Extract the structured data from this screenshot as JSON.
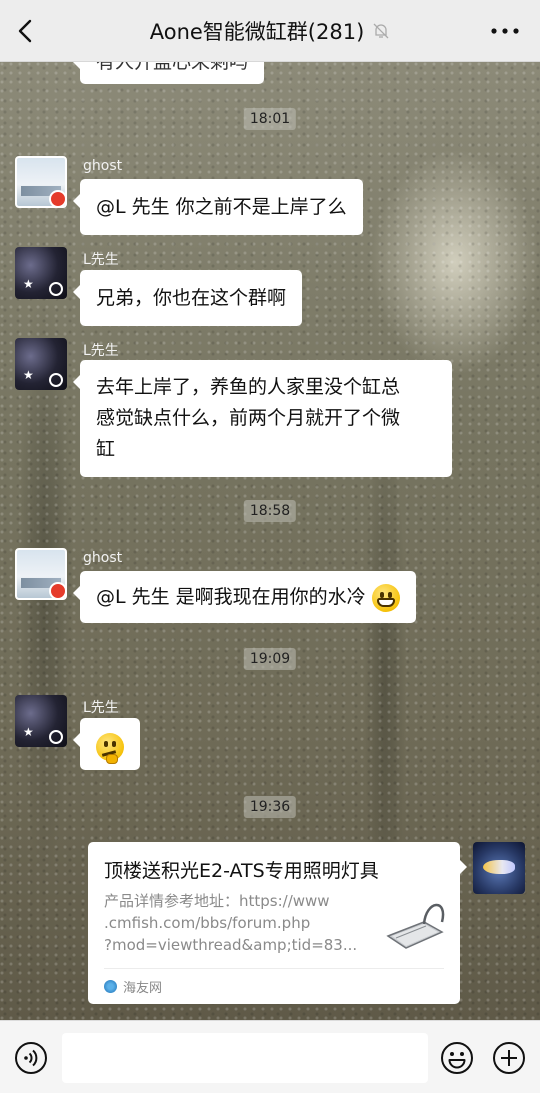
{
  "header": {
    "title": "Aone智能微缸群(281)",
    "back_icon": "chevron-left-icon",
    "mute_icon": "bell-mute-icon",
    "more_icon": "more-dots-icon"
  },
  "chat": {
    "partial_message": "有人开盖心来剩吗",
    "timestamps": [
      "18:01",
      "18:58",
      "19:09",
      "19:36"
    ],
    "messages": [
      {
        "sender": "ghost",
        "text": "@L 先生  你之前不是上岸了么"
      },
      {
        "sender": "L先生",
        "text": "兄弟，你也在这个群啊"
      },
      {
        "sender": "L先生",
        "lines": [
          "去年上岸了，养鱼的人家里没个缸总",
          "感觉缺点什么，前两个月就开了个微",
          "缸"
        ]
      },
      {
        "sender": "ghost",
        "text": "@L 先生  是啊我现在用你的水冷"
      },
      {
        "sender": "L先生",
        "emoji": "thinking-emoji"
      }
    ],
    "link_card": {
      "title": "顶楼送积光E2-ATS专用照明灯具",
      "desc_lines": [
        "产品详情参考地址：https://www",
        ".cmfish.com/bbs/forum.php",
        "?mod=viewthread&amp;tid=83..."
      ],
      "source": "海友网"
    }
  },
  "input_bar": {
    "voice_icon": "voice-icon",
    "emoji_icon": "emoji-icon",
    "plus_icon": "plus-icon",
    "placeholder": ""
  },
  "colors": {
    "bubble": "#ffffff",
    "topbar": "#ededed"
  }
}
